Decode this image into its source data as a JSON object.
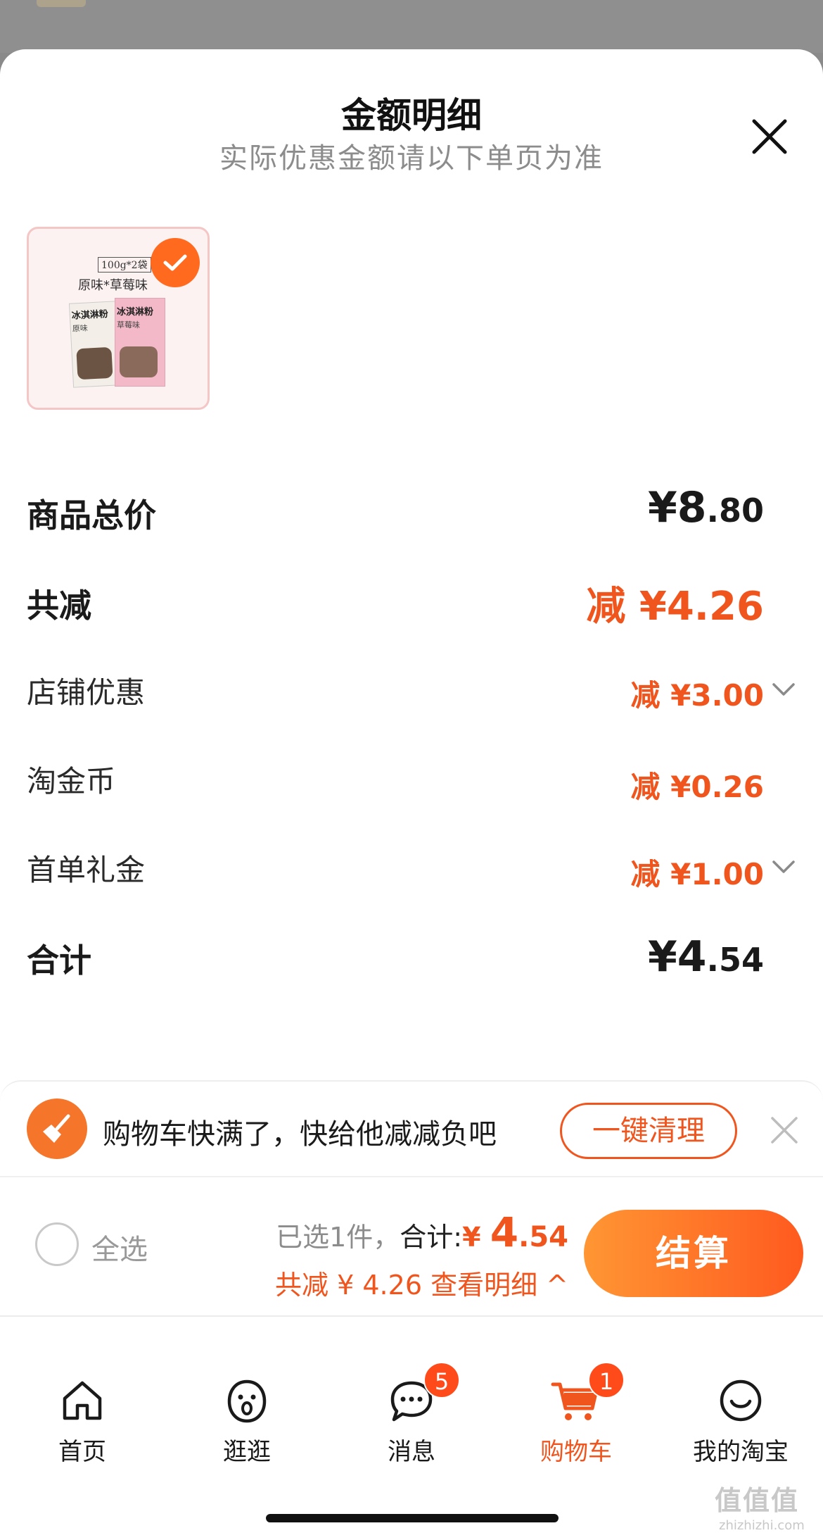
{
  "header": {
    "title": "金额明细",
    "subtitle": "实际优惠金额请以下单页为准"
  },
  "product": {
    "pack_label": "100g*2袋",
    "flavors": "原味*草莓味",
    "brand_text": "冰淇淋粉",
    "left_flavor": "原味",
    "right_flavor": "草莓味",
    "selected": true
  },
  "breakdown": {
    "total_label": "商品总价",
    "total_currency": "¥",
    "total_int": "8",
    "total_dec": ".80",
    "reduce_label": "共减",
    "reduce_value": "减 ¥4.26",
    "items": [
      {
        "label": "店铺优惠",
        "value": "减 ¥3.00",
        "expandable": true
      },
      {
        "label": "淘金币",
        "value": "减 ¥0.26",
        "expandable": false
      },
      {
        "label": "首单礼金",
        "value": "减 ¥1.00",
        "expandable": true
      }
    ],
    "sum_label": "合计",
    "sum_currency": "¥",
    "sum_int": "4",
    "sum_dec": ".54"
  },
  "notice": {
    "text": "购物车快满了，快给他减减负吧",
    "button": "一键清理"
  },
  "checkout": {
    "select_all": "全选",
    "selected_text": "已选1件，",
    "total_label": "合计:",
    "currency": "¥ ",
    "price_int": "4",
    "price_dec": ".54",
    "saving_text": "共减 ¥ 4.26  查看明细 ^",
    "pay_button": "结算"
  },
  "tabs": [
    {
      "label": "首页",
      "icon": "home-icon"
    },
    {
      "label": "逛逛",
      "icon": "face-icon"
    },
    {
      "label": "消息",
      "icon": "message-icon",
      "badge": "5"
    },
    {
      "label": "购物车",
      "icon": "cart-icon",
      "badge": "1",
      "active": true
    },
    {
      "label": "我的淘宝",
      "icon": "smile-icon"
    }
  ],
  "watermark": {
    "text": "值值值",
    "url": "zhizhizhi.com"
  },
  "colors": {
    "accent": "#f0551e",
    "pay_start": "#ff9633",
    "pay_end": "#ff5a1f"
  }
}
